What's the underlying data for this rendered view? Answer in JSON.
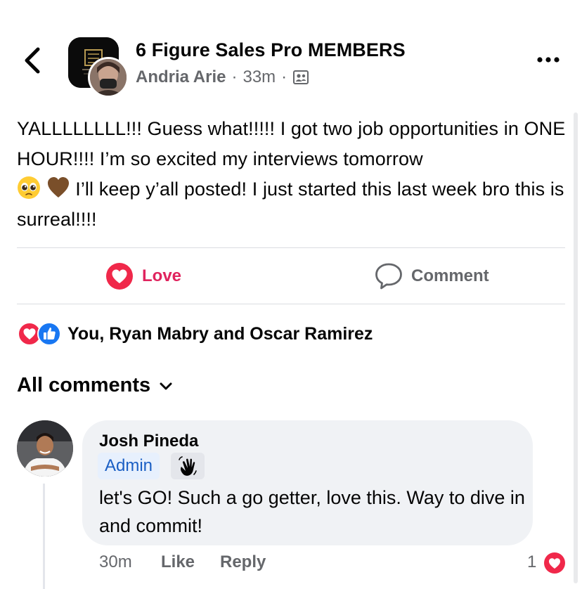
{
  "header": {
    "group_name": "6 Figure Sales Pro MEMBERS",
    "author": "Andria Arie",
    "time": "33m",
    "separator": "·"
  },
  "post": {
    "line1": "YALLLLLLLL!!! Guess what!!!!! I got two job opportunities in ONE HOUR!!!! I’m so excited my interviews tomorrow",
    "line2": "I’ll keep y’all posted! I just started this last week bro this is surreal!!!!"
  },
  "actions": {
    "love_label": "Love",
    "comment_label": "Comment"
  },
  "reactions": {
    "text": "You, Ryan Mabry and Oscar Ramirez"
  },
  "comments_header": {
    "label": "All comments"
  },
  "comment": {
    "author": "Josh Pineda",
    "badge": "Admin",
    "text": "let's GO! Such a go getter, love this. Way to dive in and commit!",
    "time": "30m",
    "like_label": "Like",
    "reply_label": "Reply",
    "reaction_count": "1"
  },
  "colors": {
    "love": "#e0245e",
    "like_blue": "#1877f2",
    "admin_text": "#1b5fc4",
    "admin_bg": "#e7f0fd",
    "bubble_bg": "#f0f2f5",
    "muted_text": "#65676b"
  }
}
